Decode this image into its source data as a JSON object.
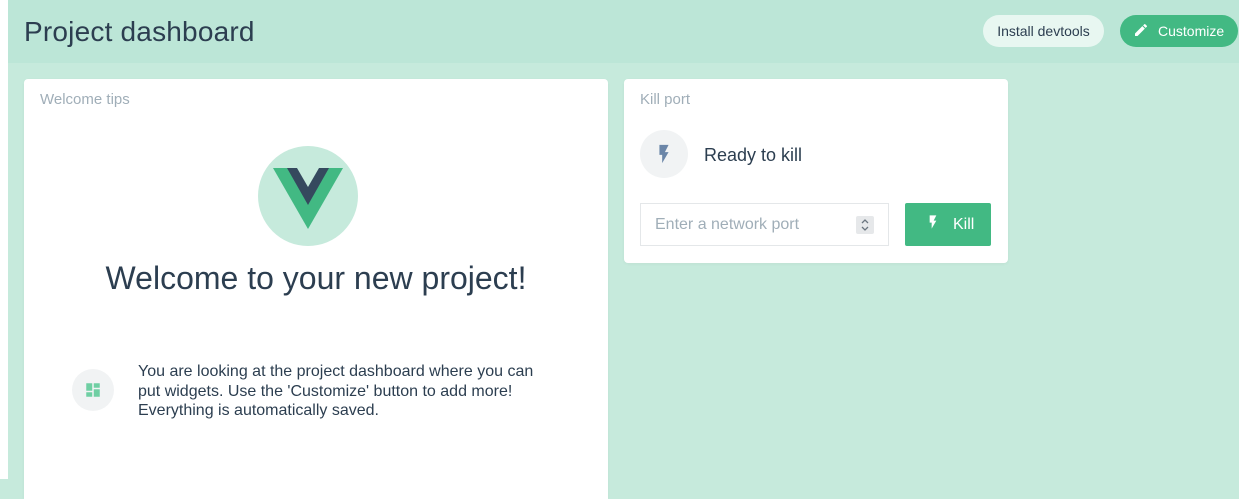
{
  "header": {
    "title": "Project dashboard",
    "devtools_label": "Install devtools",
    "customize_label": "Customize",
    "customize_icon": "pencil-icon"
  },
  "welcome_widget": {
    "title": "Welcome tips",
    "logo": "vue-logo",
    "heading": "Welcome to your new project!",
    "tip_icon": "dashboard-icon",
    "tip_text": "You are looking at the project dashboard where you can put widgets. Use the 'Customize' button to add more! Everything is automatically saved."
  },
  "kill_port_widget": {
    "title": "Kill port",
    "status_icon": "flash-icon",
    "status_text": "Ready to kill",
    "port_input_value": "",
    "port_input_placeholder": "Enter a network port",
    "kill_label": "Kill",
    "kill_icon": "flash-icon"
  },
  "colors": {
    "accent": "#42b983",
    "background": "#c6eadc",
    "header_bg": "#bce6d7",
    "text": "#2c3e50",
    "muted": "#a0aeb8",
    "vue_dark": "#35495e"
  }
}
